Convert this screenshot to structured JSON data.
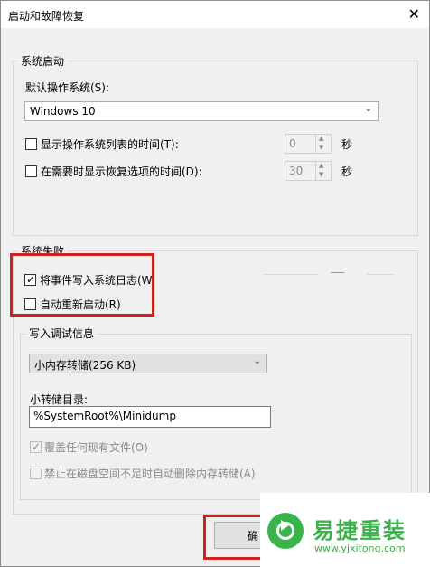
{
  "window": {
    "title": "启动和故障恢复",
    "close_glyph": "✕"
  },
  "startup": {
    "group_label": "系统启动",
    "default_os_label": "默认操作系统(S):",
    "default_os_value": "Windows 10",
    "show_list_label": "显示操作系统列表的时间(T):",
    "show_list_checked": false,
    "show_list_value": "0",
    "show_recovery_label": "在需要时显示恢复选项的时间(D):",
    "show_recovery_checked": false,
    "show_recovery_value": "30",
    "seconds_unit": "秒"
  },
  "failure": {
    "group_label": "系统失败",
    "write_event_label": "将事件写入系统日志(W",
    "write_event_checked": true,
    "auto_restart_label": "自动重新启动(R)",
    "auto_restart_checked": false,
    "debug_group_label": "写入调试信息",
    "debug_type_value": "小内存转储(256 KB)",
    "dump_dir_label": "小转储目录:",
    "dump_dir_value": "%SystemRoot%\\Minidump",
    "overwrite_label": "覆盖任何现有文件(O)",
    "overwrite_checked": true,
    "disable_auto_delete_label": "禁止在磁盘空间不足时自动删除内存转储(A)",
    "disable_auto_delete_checked": false
  },
  "buttons": {
    "ok_label": "确"
  },
  "watermark": {
    "name": "易捷重装",
    "url": "www.yjxitong.com"
  },
  "colors": {
    "highlight_red": "#d0211c",
    "logo_green": "#39b34a"
  }
}
